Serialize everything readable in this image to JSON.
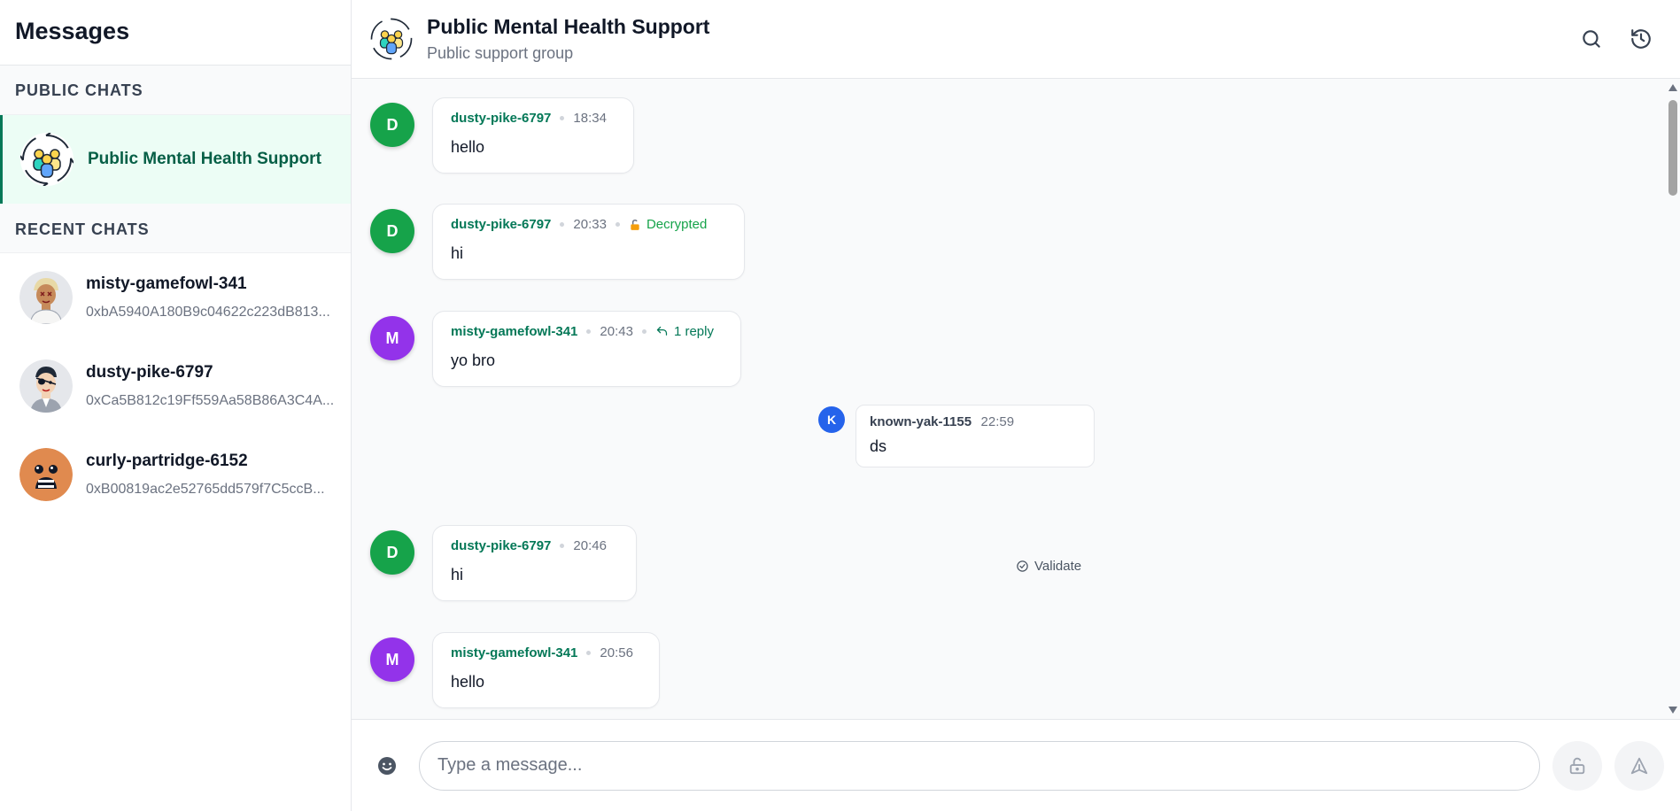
{
  "sidebar": {
    "title": "Messages",
    "public_header": "PUBLIC CHATS",
    "public_chat": {
      "name": "Public Mental Health Support"
    },
    "recent_header": "RECENT CHATS",
    "recent": [
      {
        "name": "misty-gamefowl-341",
        "address": "0xbA5940A180B9c04622c223dB813..."
      },
      {
        "name": "dusty-pike-6797",
        "address": "0xCa5B812c19Ff559Aa58B86A3C4A..."
      },
      {
        "name": "curly-partridge-6152",
        "address": "0xB00819ac2e52765dd579f7C5ccB..."
      }
    ]
  },
  "header": {
    "title": "Public Mental Health Support",
    "subtitle": "Public support group",
    "icons": [
      "search-icon",
      "history-icon"
    ]
  },
  "messages": [
    {
      "initial": "D",
      "sender": "dusty-pike-6797",
      "time": "18:34",
      "text": "hello"
    },
    {
      "initial": "D",
      "sender": "dusty-pike-6797",
      "time": "20:33",
      "status": "Decrypted",
      "text": "hi"
    },
    {
      "initial": "M",
      "sender": "misty-gamefowl-341",
      "time": "20:43",
      "replies": "1 reply",
      "text": "yo bro"
    },
    {
      "initial": "D",
      "sender": "dusty-pike-6797",
      "time": "20:46",
      "text": "hi"
    },
    {
      "initial": "M",
      "sender": "misty-gamefowl-341",
      "time": "20:56",
      "text": "hello"
    }
  ],
  "reply": {
    "initial": "K",
    "sender": "known-yak-1155",
    "time": "22:59",
    "text": "ds",
    "validate_label": "Validate"
  },
  "composer": {
    "placeholder": "Type a message..."
  },
  "colors": {
    "accent": "#047857",
    "green_avatar": "#16a34a",
    "purple_avatar": "#9333ea",
    "blue_avatar": "#2563eb"
  }
}
